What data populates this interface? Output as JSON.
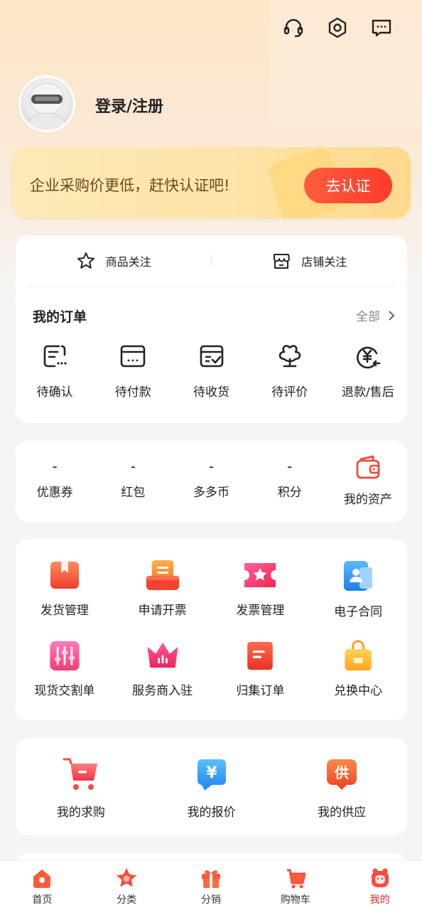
{
  "header": {
    "login_label": "登录/注册",
    "icons": [
      "headset-icon",
      "settings-hexagon-icon",
      "message-icon"
    ]
  },
  "cert_banner": {
    "text": "企业采购价更低，赶快认证吧!",
    "button": "去认证"
  },
  "follow": {
    "goods": "商品关注",
    "store": "店铺关注"
  },
  "orders": {
    "title": "我的订单",
    "all": "全部",
    "items": [
      {
        "label": "待确认",
        "icon": "pending-confirm-icon"
      },
      {
        "label": "待付款",
        "icon": "wallet-card-icon"
      },
      {
        "label": "待收货",
        "icon": "box-check-icon"
      },
      {
        "label": "待评价",
        "icon": "flower-review-icon"
      },
      {
        "label": "退款/售后",
        "icon": "refund-yen-icon"
      }
    ]
  },
  "assets": {
    "items": [
      {
        "value": "-",
        "label": "优惠券"
      },
      {
        "value": "-",
        "label": "红包"
      },
      {
        "value": "-",
        "label": "多多币"
      },
      {
        "value": "-",
        "label": "积分"
      }
    ],
    "wallet_label": "我的资产"
  },
  "services": {
    "items": [
      {
        "label": "发货管理",
        "icon": "shipping-box-icon"
      },
      {
        "label": "申请开票",
        "icon": "invoice-apply-icon"
      },
      {
        "label": "发票管理",
        "icon": "invoice-ticket-icon"
      },
      {
        "label": "电子合同",
        "icon": "contract-icon"
      },
      {
        "label": "现货交割单",
        "icon": "sliders-icon"
      },
      {
        "label": "服务商入驻",
        "icon": "crown-icon"
      },
      {
        "label": "归集订单",
        "icon": "collect-order-icon"
      },
      {
        "label": "兑换中心",
        "icon": "gift-bag-icon"
      }
    ]
  },
  "buy": {
    "items": [
      {
        "label": "我的求购",
        "icon": "shopping-cart-icon"
      },
      {
        "label": "我的报价",
        "icon": "quote-yen-icon"
      },
      {
        "label": "我的供应",
        "icon": "supply-icon"
      }
    ],
    "supply_char": "供",
    "yen_char": "¥"
  },
  "tabbar": {
    "items": [
      {
        "label": "首页",
        "icon": "home-icon"
      },
      {
        "label": "分类",
        "icon": "category-star-icon"
      },
      {
        "label": "分销",
        "icon": "gift-icon"
      },
      {
        "label": "购物车",
        "icon": "cart-icon"
      },
      {
        "label": "我的",
        "icon": "profile-icon"
      }
    ],
    "active_index": 4
  },
  "colors": {
    "accent": "#e02e24",
    "cert_button": "#ff4630",
    "icon_orange": "#ff6a2e"
  }
}
